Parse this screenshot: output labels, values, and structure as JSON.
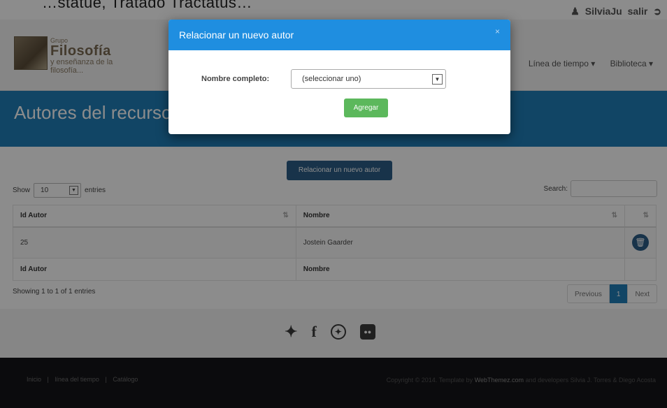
{
  "top": {
    "cut_text": "…statue, Tratado Tractatus…",
    "user": "SilviaJu",
    "logout": "salir"
  },
  "header": {
    "logo": {
      "grupo": "Grupo",
      "title": "Filosofía",
      "sub1": "y enseñanza de la",
      "sub2": "filosofía..."
    },
    "nav": {
      "timeline": "Línea de tiempo ▾",
      "library": "Biblioteca ▾"
    }
  },
  "banner": {
    "title": "Autores del recurso:"
  },
  "main": {
    "relate_button": "Relacionar un nuevo autor",
    "show_label": "Show",
    "entries_value": "10",
    "entries_label": "entries",
    "search_label": "Search:",
    "table": {
      "headers": [
        "Id Autor",
        "Nombre",
        ""
      ],
      "rows": [
        {
          "id": "25",
          "name": "Jostein Gaarder"
        }
      ],
      "footer": [
        "Id Autor",
        "Nombre",
        ""
      ]
    },
    "info": "Showing 1 to 1 of 1 entries",
    "pager": {
      "previous": "Previous",
      "current": "1",
      "next": "Next"
    }
  },
  "social": {
    "icons": [
      "twitter-icon",
      "facebook-icon",
      "dribbble-icon",
      "flickr-icon"
    ]
  },
  "footer": {
    "links": [
      "Inicio",
      "línea del tiempo",
      "Catálogo"
    ],
    "copy_prefix": "Copyright © 2014. Template by",
    "copy_brand": "WebThemez.com",
    "copy_suffix": "and developers Silvia J. Torres & Diego Acosta"
  },
  "modal": {
    "title": "Relacionar un nuevo autor",
    "close": "×",
    "field_label": "Nombre completo:",
    "select_value": "(seleccionar uno)",
    "add_button": "Agregar"
  },
  "colors": {
    "banner": "#1f7fb9",
    "modal_header": "#1f8ee0",
    "add_button": "#5cb85c",
    "relate_button": "#2c5e87"
  }
}
